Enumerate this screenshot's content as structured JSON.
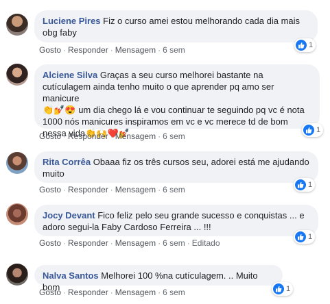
{
  "comments": [
    {
      "author": "Luciene Pires",
      "text": "Fiz o curso amei estou melhorando cada dia mais obg faby",
      "actions": {
        "like": "Gosto",
        "reply": "Responder",
        "message": "Mensagem",
        "time": "6 sem"
      },
      "reactions": "1"
    },
    {
      "author": "Alciene Silva",
      "text_lines": [
        "Graças a seu curso melhorei bastante na",
        "cutículagem ainda tenho muito o que aprender pq amo ser manicure",
        "um dia chego lá e vou continuar te seguindo pq vc é nota",
        "1000 nós manicures inspiramos em vc e vc merece td de bom",
        "nessa vida"
      ],
      "emojis_line3": "👏💅😍",
      "emojis_end": "👏🙌❤️💅",
      "actions": {
        "like": "Gosto",
        "reply": "Responder",
        "message": "Mensagem",
        "time": "6 sem"
      },
      "reactions": "1"
    },
    {
      "author": "Rita Corrêa",
      "text": "Obaaa fiz os três cursos seu, adorei está me ajudando muito",
      "actions": {
        "like": "Gosto",
        "reply": "Responder",
        "message": "Mensagem",
        "time": "6 sem"
      },
      "reactions": "1"
    },
    {
      "author": "Jocy Devant",
      "text": "Fico feliz pelo seu grande sucesso e conquistas ... e adoro segui-la Faby Cardoso Ferreira ... !!!",
      "actions": {
        "like": "Gosto",
        "reply": "Responder",
        "message": "Mensagem",
        "time": "6 sem",
        "edited": "Editado"
      },
      "reactions": "1"
    },
    {
      "author": "Nalva Santos",
      "text": "Melhorei 100 %na cutículagem. .. Muito bom",
      "actions": {
        "like": "Gosto",
        "reply": "Responder",
        "message": "Mensagem",
        "time": "6 sem"
      },
      "reactions": "1"
    }
  ],
  "colors": {
    "author": "#385898",
    "bubble": "#f0f2f5",
    "like": "#1877f2"
  },
  "icons": {
    "reaction": "like-icon"
  }
}
